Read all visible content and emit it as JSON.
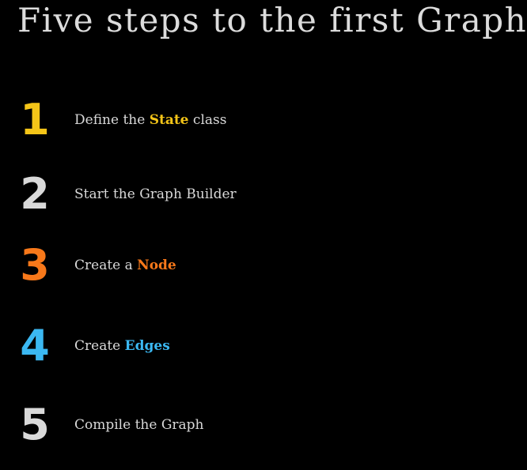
{
  "title": "Five steps to the first Graph",
  "colors": {
    "background": "#000000",
    "yellow": "#f5c518",
    "white": "#d9d9d9",
    "orange": "#f7781a",
    "blue": "#3bb8f2"
  },
  "steps": [
    {
      "number": "1",
      "before": "Define the ",
      "highlight": "State",
      "after": " class"
    },
    {
      "number": "2",
      "before": "Start the Graph Builder",
      "highlight": "",
      "after": ""
    },
    {
      "number": "3",
      "before": "Create a ",
      "highlight": "Node",
      "after": ""
    },
    {
      "number": "4",
      "before": "Create ",
      "highlight": "Edges",
      "after": ""
    },
    {
      "number": "5",
      "before": "Compile the Graph",
      "highlight": "",
      "after": ""
    }
  ]
}
